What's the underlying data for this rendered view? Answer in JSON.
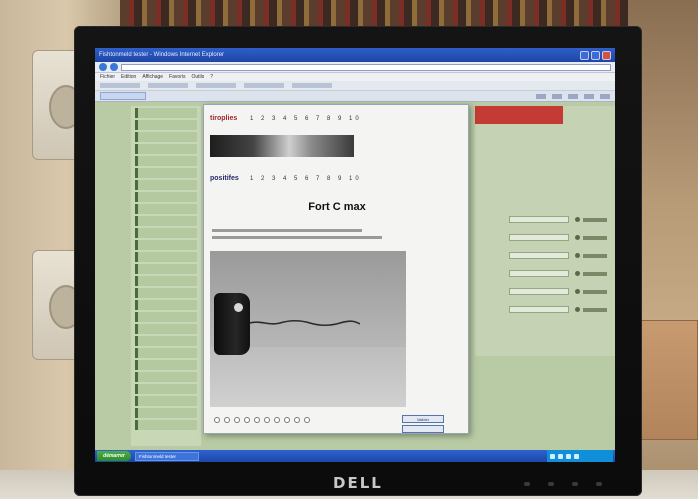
{
  "scene": {
    "monitor_brand": "DELL"
  },
  "browser": {
    "window_title": "Fishtonmeld tester - Windows Internet Explorer",
    "menu_items": [
      "Fichier",
      "Edition",
      "Affichage",
      "Favoris",
      "Outils",
      "?"
    ],
    "start_label": "démarrer",
    "task_label": "Fishtonmeld tester"
  },
  "popup": {
    "row1_label": "tiroplies",
    "row1_digits": "1 2 3 4 5 6 7 8 9 10",
    "row2_label": "positifes",
    "row2_digits": "1 2 3 4 5 6 7 8 9 10",
    "title": "Fort C max",
    "button_label": "Valider"
  },
  "colors": {
    "page_bg": "#b8cba4",
    "banner_red": "#c43a34",
    "titlebar_blue": "#1e45a6"
  }
}
